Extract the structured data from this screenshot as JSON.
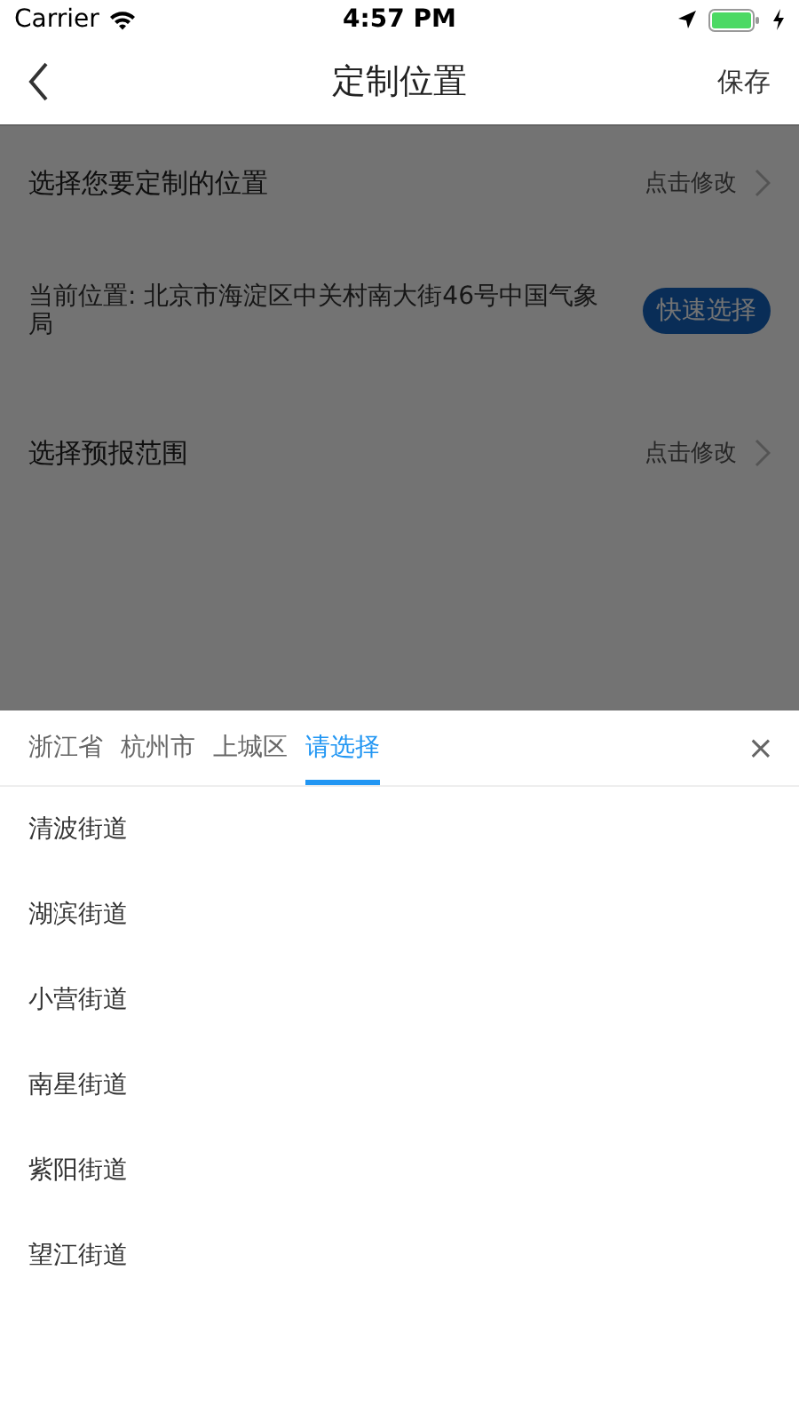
{
  "status_bar": {
    "carrier": "Carrier",
    "time": "4:57 PM"
  },
  "nav": {
    "title": "定制位置",
    "action": "保存"
  },
  "rows": [
    {
      "kind": "link",
      "label": "选择您要定制的位置",
      "hint": "点击修改"
    },
    {
      "kind": "location",
      "label": "当前位置: 北京市海淀区中关村南大街46号中国气象局",
      "button": "快速选择"
    },
    {
      "kind": "link",
      "label": "选择预报范围",
      "hint": "点击修改"
    }
  ],
  "picker": {
    "tabs": [
      {
        "label": "浙江省",
        "selected": false
      },
      {
        "label": "杭州市",
        "selected": false
      },
      {
        "label": "上城区",
        "selected": false
      },
      {
        "label": "请选择",
        "selected": true
      }
    ],
    "close": "×",
    "options": [
      "清波街道",
      "湖滨街道",
      "小营街道",
      "南星街道",
      "紫阳街道",
      "望江街道"
    ]
  }
}
